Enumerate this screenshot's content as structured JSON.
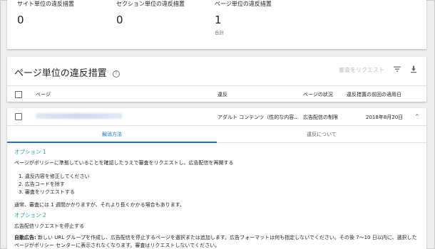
{
  "stats": [
    {
      "label": "サイト単位の違反措置",
      "value": "0",
      "sub": ""
    },
    {
      "label": "セクション単位の違反措置",
      "value": "0",
      "sub": ""
    },
    {
      "label": "ページ単位の違反措置",
      "value": "1",
      "sub": "合計"
    }
  ],
  "issues": {
    "title": "ページ単位の違反措置",
    "help_icon": "?",
    "request_review": "審査をリクエスト",
    "columns": [
      "ページ",
      "違反",
      "ページの状況",
      "違反措置の前回の適用日"
    ]
  },
  "row": {
    "violation": "アダルト コンテンツ（性的な内容...",
    "status": "広告配信の制限",
    "date": "2018年8月20日"
  },
  "tabs": [
    "解消方法",
    "違反について"
  ],
  "content": {
    "option1": "オプション 1",
    "intro": "ページがポリシーに準拠していることを確認したうえで審査をリクエストし、広告配信を再開する",
    "steps": [
      "1. 違反内容を修正してください",
      "2. 広告コードを除す",
      "3. 審査をリクエストする"
    ],
    "note": "通常、審査には 1 週間かかりますが、それより長くかかる場合もあります。",
    "option2": "オプション 2",
    "stop": "広告配信リクエストを停止する",
    "auto_label": "自動広告:",
    "auto_text": " 新しい URL グループを作成し、広告配信を停止するページを選択または追加します。広告フォーマットは何も指定しないでください。その後 7～10 日以内に、選択した",
    "auto_text2": "ページがポリシー センターに表示されなくなります。審査はリクエストしないでください。"
  }
}
